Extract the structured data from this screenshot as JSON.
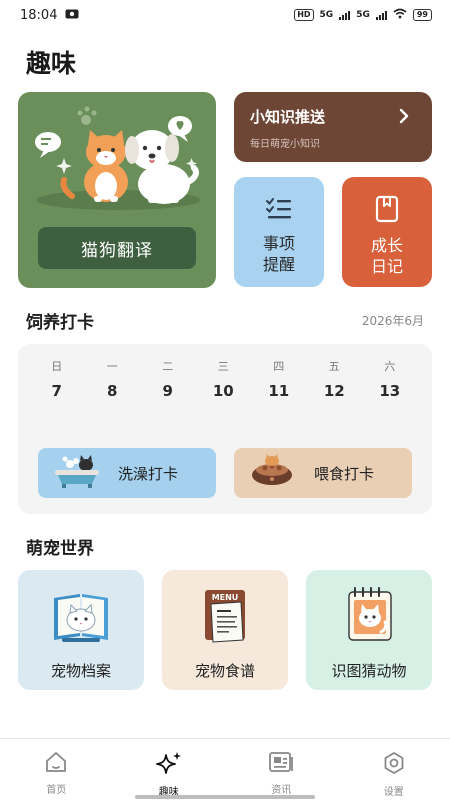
{
  "status": {
    "time": "18:04",
    "hd": "HD",
    "sig1": "5G",
    "sig2": "5G",
    "battery": "99"
  },
  "page": {
    "title": "趣味"
  },
  "features": {
    "translator": {
      "label": "猫狗翻译"
    },
    "tips": {
      "title": "小知识推送",
      "subtitle": "每日萌宠小知识",
      "arrow": "›"
    },
    "todo": {
      "line1": "事项",
      "line2": "提醒"
    },
    "diary": {
      "line1": "成长",
      "line2": "日记"
    }
  },
  "feeding": {
    "title": "饲养打卡",
    "date": "2026年6月",
    "weekdays": [
      "日",
      "一",
      "二",
      "三",
      "四",
      "五",
      "六"
    ],
    "days": [
      "7",
      "8",
      "9",
      "10",
      "11",
      "12",
      "13"
    ],
    "bath_label": "洗澡打卡",
    "feed_label": "喂食打卡"
  },
  "world": {
    "title": "萌宠世界",
    "items": [
      {
        "label": "宠物档案"
      },
      {
        "label": "宠物食谱",
        "menu_text": "MENU"
      },
      {
        "label": "识图猜动物"
      }
    ]
  },
  "tabs": [
    {
      "label": "首页",
      "icon": "home-icon"
    },
    {
      "label": "趣味",
      "icon": "sparkle-icon"
    },
    {
      "label": "资讯",
      "icon": "news-icon"
    },
    {
      "label": "设置",
      "icon": "settings-icon"
    }
  ],
  "colors": {
    "translator_bg": "#6a8f5a",
    "tips_bg": "#6e4636",
    "todo_bg": "#a8d2ef",
    "diary_bg": "#d8603a"
  }
}
